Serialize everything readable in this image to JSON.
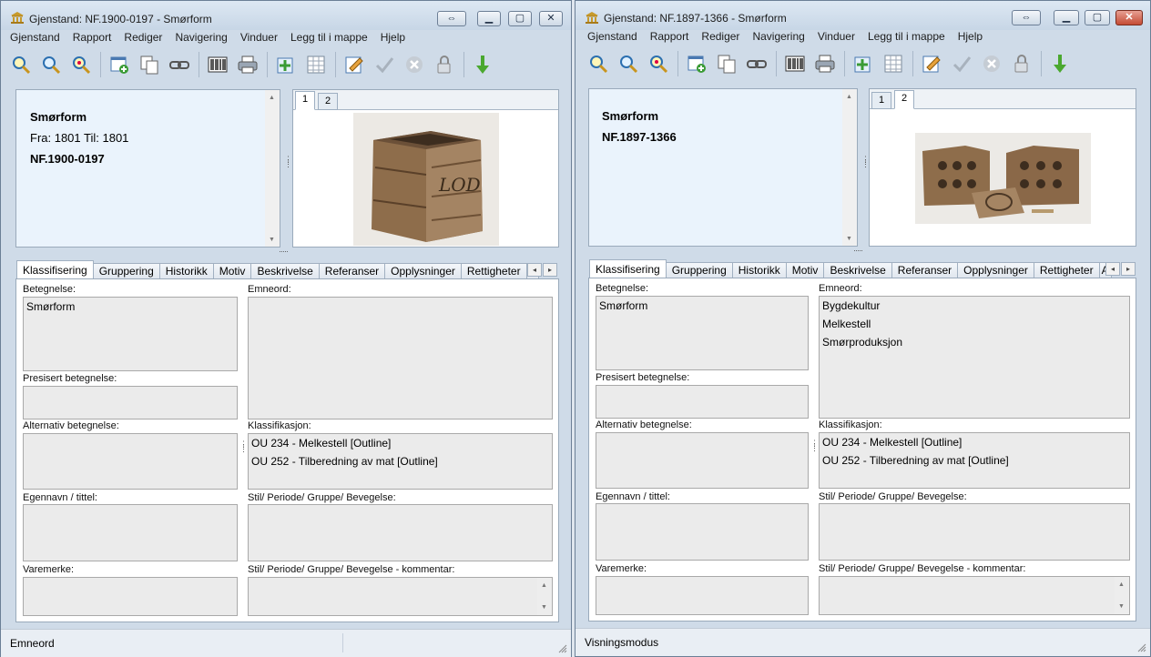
{
  "menu": [
    "Gjenstand",
    "Rapport",
    "Rediger",
    "Navigering",
    "Vinduer",
    "Legg til i mappe",
    "Hjelp"
  ],
  "toolbar_icons": [
    "search-icon",
    "search-alt-icon",
    "search-advanced-icon",
    "new-record-icon",
    "copy-record-icon",
    "link-icon",
    "barcode-icon",
    "print-icon",
    "add-to-list-icon",
    "list-icon",
    "edit-icon",
    "check-icon",
    "cancel-icon",
    "lock-icon",
    "download-arrow-icon"
  ],
  "tabs": [
    "Klassifisering",
    "Gruppering",
    "Historikk",
    "Motiv",
    "Beskrivelse",
    "Referanser",
    "Opplysninger",
    "Rettigheter",
    "A"
  ],
  "labels": {
    "betegnelse": "Betegnelse:",
    "presisert": "Presisert betegnelse:",
    "alternativ": "Alternativ betegnelse:",
    "egennavn": "Egennavn / tittel:",
    "varemerke": "Varemerke:",
    "emneord": "Emneord:",
    "klassifikasjon": "Klassifikasjon:",
    "stil": "Stil/ Periode/ Gruppe/ Bevegelse:",
    "stil_kommentar": "Stil/ Periode/ Gruppe/ Bevegelse  - kommentar:"
  },
  "image_tabs": [
    "1",
    "2"
  ],
  "left": {
    "title": "Gjenstand: NF.1900-0197  - Smørform",
    "name": "Smørform",
    "dates": "Fra:  1801 Til:  1801",
    "id": "NF.1900-0197",
    "active_image_tab": "1",
    "betegnelse": "Smørform",
    "emneord": [],
    "klassifikasjon": [
      "OU 234 - Melkestell [Outline]",
      "OU 252 - Tilberedning av mat [Outline]"
    ],
    "status": "Emneord"
  },
  "right": {
    "title": "Gjenstand: NF.1897-1366  - Smørform",
    "name": "Smørform",
    "id": "NF.1897-1366",
    "active_image_tab": "2",
    "betegnelse": "Smørform",
    "emneord": [
      "Bygdekultur",
      "Melkestell",
      "Smørproduksjon"
    ],
    "klassifikasjon": [
      "OU 234 - Melkestell [Outline]",
      "OU 252 - Tilberedning av mat [Outline]"
    ],
    "status": "Visningsmodus"
  },
  "colors": {
    "titlebar": "#c7d6e6",
    "info_panel": "#eaf3fc",
    "field": "#ebebeb",
    "close_button": "#c44b34"
  }
}
